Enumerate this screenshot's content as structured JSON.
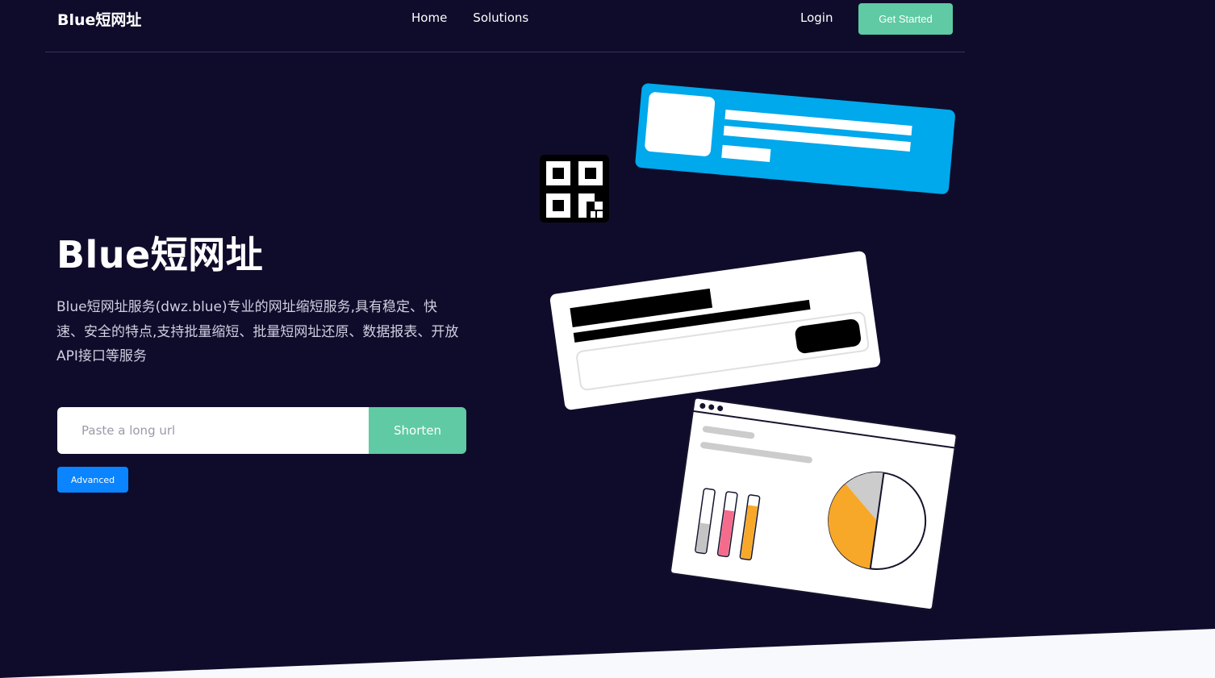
{
  "nav": {
    "brand": "Blue短网址",
    "links": [
      "Home",
      "Solutions"
    ],
    "login": "Login",
    "cta": "Get Started"
  },
  "hero": {
    "title": "Blue短网址",
    "description": "Blue短网址服务(dwz.blue)专业的网址缩短服务,具有稳定、快速、安全的特点,支持批量缩短、批量短网址还原、数据报表、开放API接口等服务"
  },
  "form": {
    "placeholder": "Paste a long url",
    "value": "",
    "submit_label": "Shorten",
    "advanced_label": "Advanced"
  },
  "colors": {
    "background": "#0f0c2b",
    "accent_green": "#5fcaa3",
    "accent_blue": "#0a84ff",
    "card_blue": "#00a8ec"
  },
  "icons": [
    "qr-code-icon",
    "link-card-illustration",
    "shorten-form-illustration",
    "analytics-dashboard-illustration"
  ]
}
